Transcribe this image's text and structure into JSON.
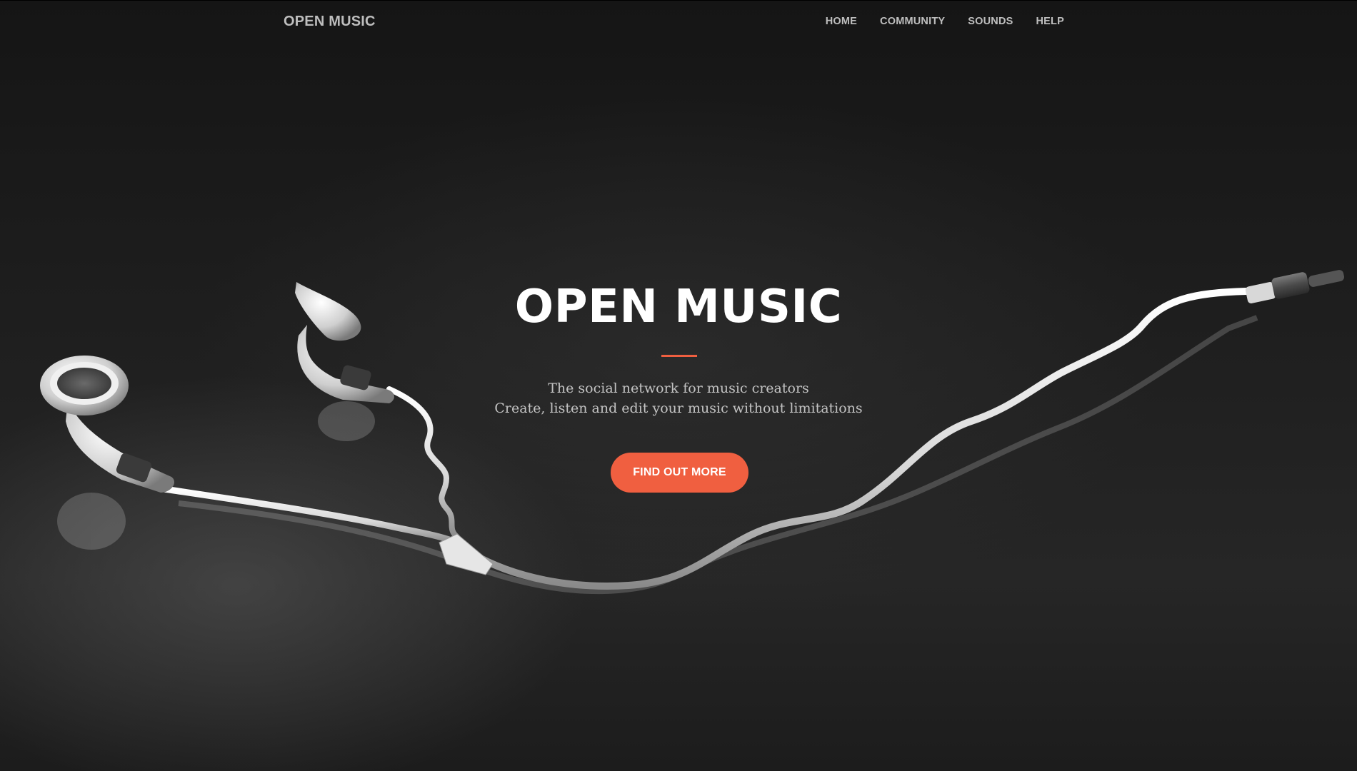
{
  "navbar": {
    "brand": "OPEN MUSIC",
    "links": [
      {
        "label": "HOME"
      },
      {
        "label": "COMMUNITY"
      },
      {
        "label": "SOUNDS"
      },
      {
        "label": "HELP"
      }
    ]
  },
  "hero": {
    "title": "OPEN MUSIC",
    "tagline_line1": "The social network for music creators",
    "tagline_line2": "Create, listen and edit your music without limitations",
    "cta_label": "FIND OUT MORE",
    "background_image": "earphones-on-dark-reflective-surface"
  },
  "colors": {
    "accent": "#f05f40",
    "background": "#1a1a1a",
    "text_primary": "#ffffff"
  }
}
